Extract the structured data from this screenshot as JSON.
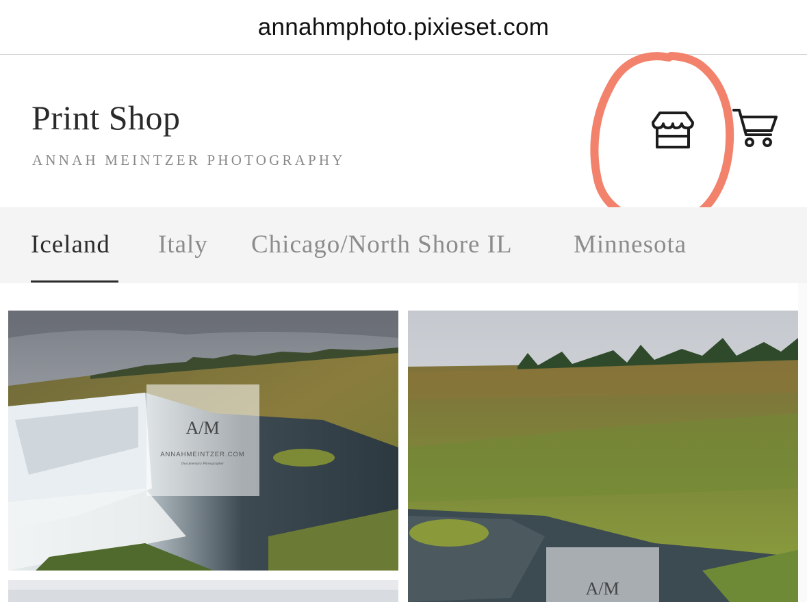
{
  "browser": {
    "url": "annahmphoto.pixieset.com"
  },
  "header": {
    "title": "Print Shop",
    "subtitle": "ANNAH MEINTZER PHOTOGRAPHY",
    "store_icon": "storefront-icon",
    "cart_icon": "shopping-cart-icon"
  },
  "tabs": [
    {
      "label": "Iceland",
      "active": true
    },
    {
      "label": "Italy",
      "active": false
    },
    {
      "label": "Chicago/North Shore IL",
      "active": false
    },
    {
      "label": "Minnesota",
      "active": false
    }
  ],
  "watermark": {
    "monogram": "A/M",
    "site": "ANNAHMEINTZER.COM",
    "tagline": "Documentary Photographer"
  },
  "colors": {
    "annotation_circle": "#f2826b",
    "active_tab": "#2b2b2b",
    "inactive_tab": "#8c8c8c",
    "tab_bar_bg": "#f4f4f4"
  }
}
